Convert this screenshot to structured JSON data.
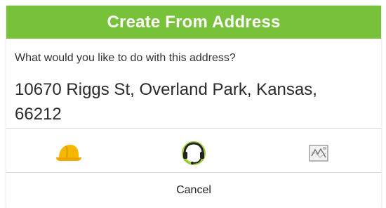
{
  "dialog": {
    "title": "Create From Address",
    "prompt": "What would you like to do with this address?",
    "address": "10670 Riggs St, Overland Park, Kansas, 66212",
    "actions": [
      {
        "icon": "hard-hat-icon"
      },
      {
        "icon": "headset-icon"
      },
      {
        "icon": "map-icon"
      }
    ],
    "cancel_label": "Cancel"
  },
  "colors": {
    "header": "#78c13a",
    "hat": "#f5b800",
    "headset_ring": "#9ccc3a"
  }
}
